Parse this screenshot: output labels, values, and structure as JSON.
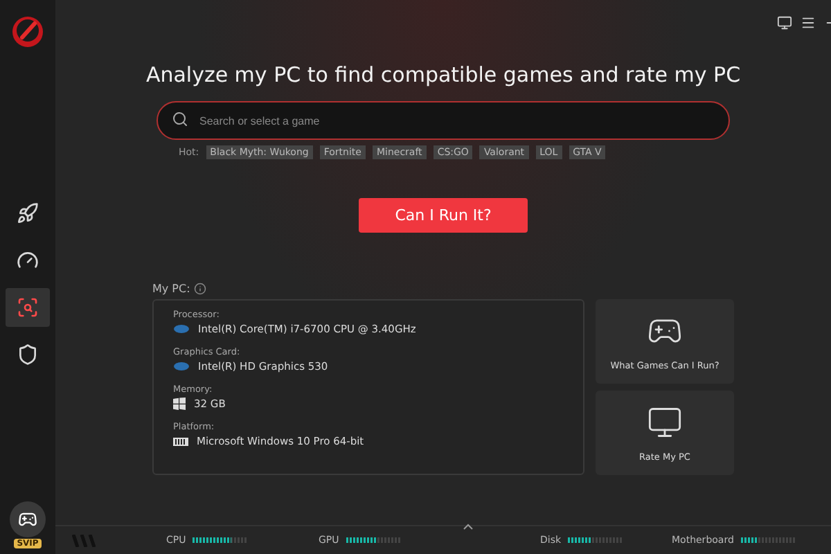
{
  "sidebar": {
    "items": [
      {
        "kind": "rocket",
        "selected": false
      },
      {
        "kind": "gauge",
        "selected": false
      },
      {
        "kind": "scan",
        "selected": true
      },
      {
        "kind": "shield",
        "selected": false
      }
    ],
    "badge": "SVIP"
  },
  "heading": "Analyze my PC to find compatible games and rate my PC",
  "search": {
    "placeholder": "Search or select a game"
  },
  "hot": {
    "label": "Hot:",
    "tags": [
      "Black Myth: Wukong",
      "Fortnite",
      "Minecraft",
      "CS:GO",
      "Valorant",
      "LOL",
      "GTA V"
    ]
  },
  "primary_button": "Can I Run It?",
  "my_pc": {
    "label": "My PC:",
    "specs": [
      {
        "kind": "cpu",
        "label": "Processor:",
        "value": "Intel(R) Core(TM) i7-6700 CPU @ 3.40GHz"
      },
      {
        "kind": "gpu",
        "label": "Graphics Card:",
        "value": "Intel(R) HD Graphics 530"
      },
      {
        "kind": "memory",
        "label": "Memory:",
        "value": "32 GB"
      },
      {
        "kind": "platform",
        "label": "Platform:",
        "value": "Microsoft Windows 10 Pro 64-bit"
      }
    ],
    "actions": [
      {
        "kind": "gamepad",
        "label": "What Games Can I Run?"
      },
      {
        "kind": "monitor",
        "label": "Rate My PC"
      }
    ]
  },
  "status_bar": {
    "meters": [
      {
        "name": "CPU",
        "level": 0.7
      },
      {
        "name": "GPU",
        "level": 0.55
      },
      {
        "name": "Disk",
        "level": 0.42
      },
      {
        "name": "Motherboard",
        "level": 0.3
      }
    ]
  }
}
